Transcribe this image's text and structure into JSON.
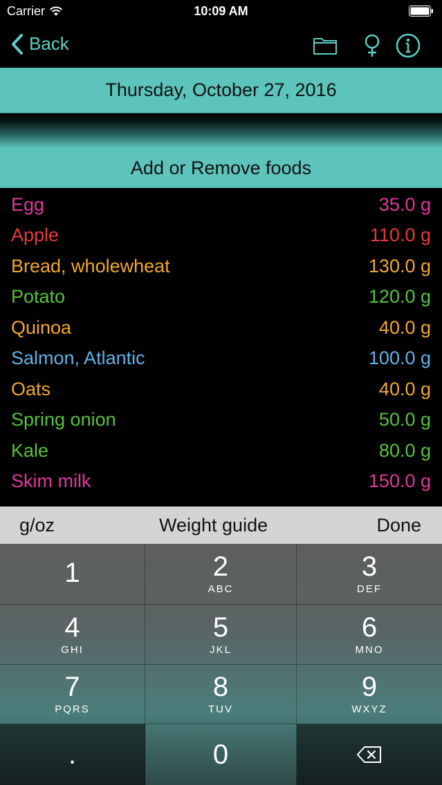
{
  "status_bar": {
    "carrier": "Carrier",
    "time": "10:09 AM"
  },
  "nav": {
    "back_label": "Back",
    "accent_color": "#5ecfc6",
    "icons": [
      "folder-icon",
      "female-symbol-icon",
      "info-icon"
    ]
  },
  "date_label": "Thursday, October 27, 2016",
  "add_remove_label": "Add or Remove foods",
  "foods": [
    {
      "name": "Egg",
      "weight": "35.0 g",
      "color": "#e0389f"
    },
    {
      "name": "Apple",
      "weight": "110.0 g",
      "color": "#e83b35"
    },
    {
      "name": "Bread, wholewheat",
      "weight": "130.0 g",
      "color": "#f2a82c"
    },
    {
      "name": "Potato",
      "weight": "120.0 g",
      "color": "#55c43b"
    },
    {
      "name": "Quinoa",
      "weight": "40.0 g",
      "color": "#f2a82c"
    },
    {
      "name": "Salmon, Atlantic",
      "weight": "100.0 g",
      "color": "#5fb3e8"
    },
    {
      "name": "Oats",
      "weight": "40.0 g",
      "color": "#f2a82c"
    },
    {
      "name": "Spring onion",
      "weight": "50.0 g",
      "color": "#55c43b"
    },
    {
      "name": "Kale",
      "weight": "80.0 g",
      "color": "#55c43b"
    },
    {
      "name": "Skim milk",
      "weight": "150.0 g",
      "color": "#e0389f"
    }
  ],
  "accessory": {
    "units_label": "g/oz",
    "guide_label": "Weight guide",
    "done_label": "Done"
  },
  "keypad": {
    "keys": [
      {
        "num": "1",
        "letters": ""
      },
      {
        "num": "2",
        "letters": "ABC"
      },
      {
        "num": "3",
        "letters": "DEF"
      },
      {
        "num": "4",
        "letters": "GHI"
      },
      {
        "num": "5",
        "letters": "JKL"
      },
      {
        "num": "6",
        "letters": "MNO"
      },
      {
        "num": "7",
        "letters": "PQRS"
      },
      {
        "num": "8",
        "letters": "TUV"
      },
      {
        "num": "9",
        "letters": "WXYZ"
      }
    ],
    "decimal": ".",
    "zero": "0"
  }
}
